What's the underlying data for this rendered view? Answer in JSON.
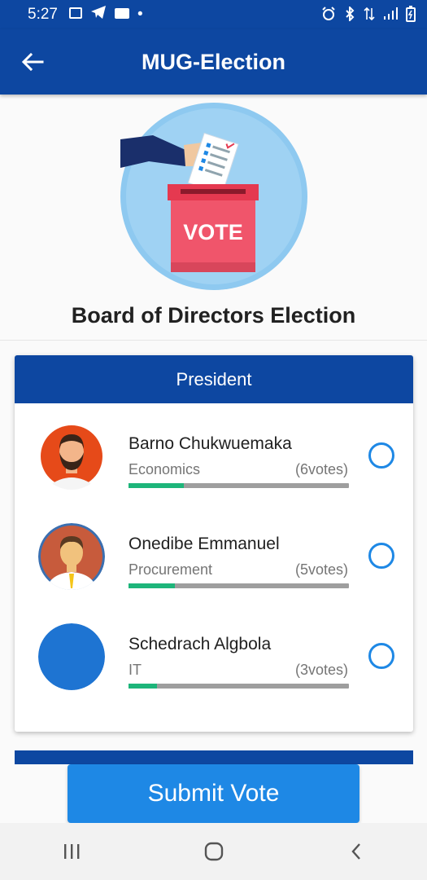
{
  "status_bar": {
    "time": "5:27",
    "left_icons": [
      "image-icon",
      "telegram-icon",
      "folder-icon",
      "dot-icon"
    ],
    "right_icons": [
      "alarm-icon",
      "bluetooth-icon",
      "data-icon",
      "signal-icon",
      "battery-icon"
    ]
  },
  "app_bar": {
    "title": "MUG-Election",
    "back_icon": "arrow-left-icon"
  },
  "hero": {
    "ballot_label": "VOTE"
  },
  "election_title": "Board of Directors Election",
  "position": {
    "title": "President",
    "candidates": [
      {
        "name": "Barno Chukwuemaka",
        "department": "Economics",
        "votes_text": "(6votes)",
        "votes": 6,
        "progress": 0.25,
        "avatar": "bearded-man-avatar"
      },
      {
        "name": "Onedibe Emmanuel",
        "department": "Procurement",
        "votes_text": "(5votes)",
        "votes": 5,
        "progress": 0.21,
        "avatar": "man-tie-avatar"
      },
      {
        "name": "Schedrach Algbola",
        "department": "IT",
        "votes_text": "(3votes)",
        "votes": 3,
        "progress": 0.13,
        "avatar": "blank-avatar"
      }
    ]
  },
  "submit_label": "Submit Vote",
  "colors": {
    "primary": "#0d47a1",
    "accent": "#1e88e5",
    "progress": "#1db57a"
  },
  "nav_bar": [
    "recent-apps-icon",
    "home-icon",
    "back-icon"
  ]
}
